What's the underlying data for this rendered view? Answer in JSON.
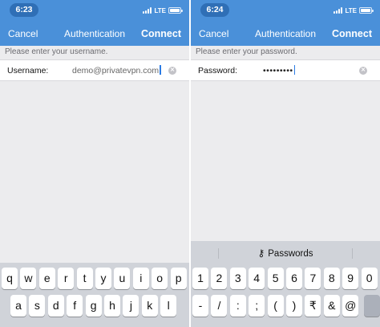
{
  "colors": {
    "header_bg": "#4a90d9",
    "time_pill": "#2f6fb6",
    "keyboard_bg": "#d0d3d9",
    "caret": "#2a7be4"
  },
  "left": {
    "status": {
      "time": "6:23",
      "network": "LTE"
    },
    "nav": {
      "cancel": "Cancel",
      "title": "Authentication",
      "connect": "Connect"
    },
    "prompt": "Please enter your username.",
    "field": {
      "label": "Username:",
      "value": "demo@privatevpn.com",
      "clear_icon": "clear-circle-icon"
    },
    "keyboard": {
      "row1": [
        "q",
        "w",
        "e",
        "r",
        "t",
        "y",
        "u",
        "i",
        "o",
        "p"
      ],
      "row2": [
        "a",
        "s",
        "d",
        "f",
        "g",
        "h",
        "j",
        "k",
        "l"
      ]
    }
  },
  "right": {
    "status": {
      "time": "6:24",
      "network": "LTE"
    },
    "nav": {
      "cancel": "Cancel",
      "title": "Authentication",
      "connect": "Connect"
    },
    "prompt": "Please enter your password.",
    "field": {
      "label": "Password:",
      "value": "•••••••••",
      "clear_icon": "clear-circle-icon"
    },
    "passwords_bar": {
      "label": "Passwords",
      "icon": "key-icon"
    },
    "keyboard": {
      "row1": [
        "1",
        "2",
        "3",
        "4",
        "5",
        "6",
        "7",
        "8",
        "9",
        "0"
      ],
      "row2": [
        "-",
        "/",
        ":",
        ";",
        "(",
        ")",
        "₹",
        "&",
        "@"
      ]
    }
  }
}
